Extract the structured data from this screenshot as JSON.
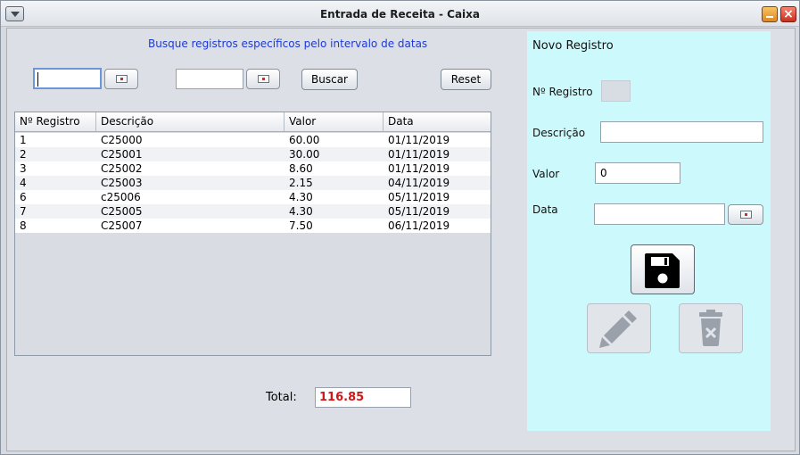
{
  "window": {
    "title": "Entrada de Receita - Caixa"
  },
  "search": {
    "hint": "Busque registros específicos pelo intervalo de datas",
    "date_from": "",
    "date_to": "",
    "buscar_label": "Buscar",
    "reset_label": "Reset"
  },
  "table": {
    "columns": [
      "Nº Registro",
      "Descrição",
      "Valor",
      "Data"
    ],
    "rows": [
      [
        "1",
        "C25000",
        "60.00",
        "01/11/2019"
      ],
      [
        "2",
        "C25001",
        "30.00",
        "01/11/2019"
      ],
      [
        "3",
        "C25002",
        "8.60",
        "01/11/2019"
      ],
      [
        "4",
        "C25003",
        "2.15",
        "04/11/2019"
      ],
      [
        "6",
        "c25006",
        "4.30",
        "05/11/2019"
      ],
      [
        "7",
        "C25005",
        "4.30",
        "05/11/2019"
      ],
      [
        "8",
        "C25007",
        "7.50",
        "06/11/2019"
      ]
    ]
  },
  "total": {
    "label": "Total:",
    "value": "116.85"
  },
  "form": {
    "title": "Novo Registro",
    "registro_label": "Nº Registro",
    "registro_value": "",
    "descricao_label": "Descrição",
    "descricao_value": "",
    "valor_label": "Valor",
    "valor_value": "0",
    "data_label": "Data",
    "data_value": ""
  },
  "icons": {
    "save": "floppy-disk-icon",
    "edit": "pencil-icon",
    "delete": "trash-icon"
  },
  "colors": {
    "hint_text": "#1d3ad9",
    "total_text": "#d01818",
    "panel_bg": "#ccfafc"
  }
}
